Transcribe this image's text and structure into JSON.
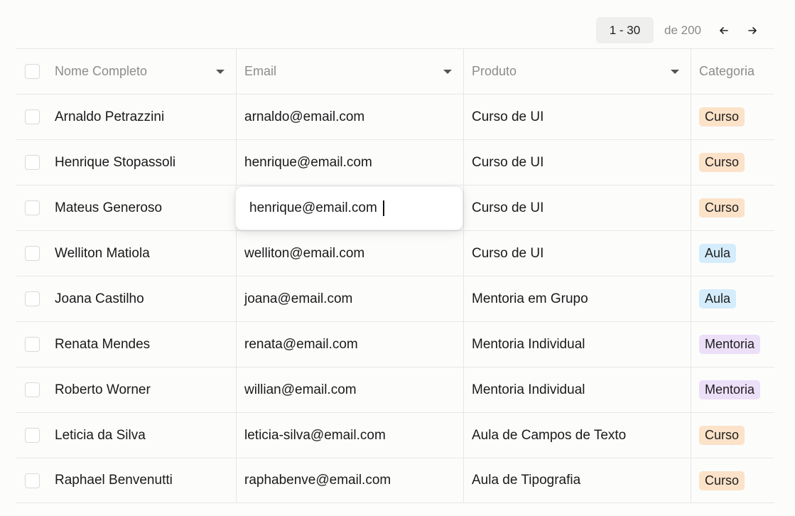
{
  "pagination": {
    "range": "1 - 30",
    "of_total": "de 200",
    "prev_icon": "arrow-left-icon",
    "next_icon": "arrow-right-icon"
  },
  "table": {
    "columns": [
      "Nome Completo",
      "Email",
      "Produto",
      "Categoria"
    ],
    "rows": [
      {
        "name": "Arnaldo Petrazzini",
        "email": "arnaldo@email.com",
        "product": "Curso de UI",
        "category": "Curso",
        "cat_style": "curso"
      },
      {
        "name": "Henrique Stopassoli",
        "email": "henrique@email.com",
        "product": "Curso de UI",
        "category": "Curso",
        "cat_style": "curso"
      },
      {
        "name": "Mateus Generoso",
        "email": "",
        "product": "Curso de UI",
        "category": "Curso",
        "cat_style": "curso"
      },
      {
        "name": "Welliton Matiola",
        "email": "welliton@email.com",
        "product": "Curso de UI",
        "category": "Aula",
        "cat_style": "aula"
      },
      {
        "name": "Joana Castilho",
        "email": "joana@email.com",
        "product": "Mentoria em Grupo",
        "category": "Aula",
        "cat_style": "aula"
      },
      {
        "name": "Renata Mendes",
        "email": "renata@email.com",
        "product": "Mentoria Individual",
        "category": "Mentoria",
        "cat_style": "mentoria"
      },
      {
        "name": "Roberto Worner",
        "email": "willian@email.com",
        "product": "Mentoria Individual",
        "category": "Mentoria",
        "cat_style": "mentoria"
      },
      {
        "name": "Leticia da Silva",
        "email": "leticia-silva@email.com",
        "product": "Aula de Campos de Texto",
        "category": "Curso",
        "cat_style": "curso"
      },
      {
        "name": "Raphael Benvenutti",
        "email": "raphabenve@email.com",
        "product": "Aula de Tipografia",
        "category": "Curso",
        "cat_style": "curso"
      }
    ]
  },
  "editor": {
    "value": "henrique@email.com"
  },
  "colors": {
    "curso_badge": "#fbe2c8",
    "aula_badge": "#d4ecfb",
    "mentoria_badge": "#ecdff8"
  }
}
